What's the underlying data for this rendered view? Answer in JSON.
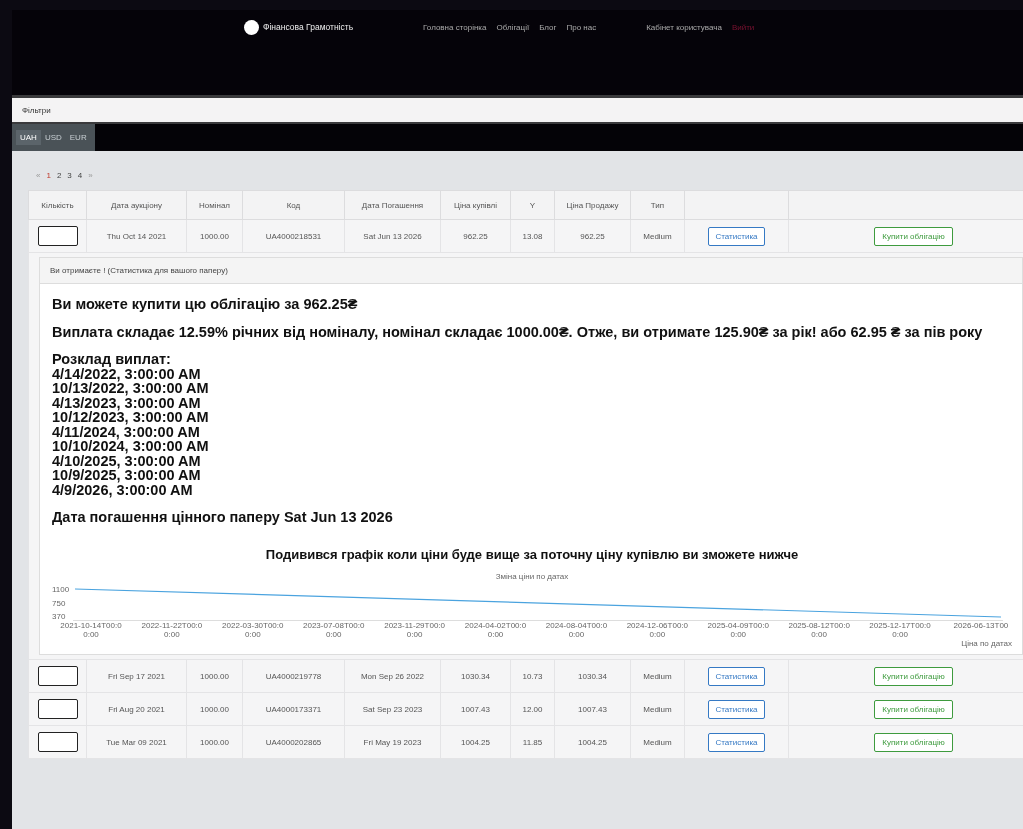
{
  "header": {
    "brand": "Фінансова Грамотність",
    "nav": [
      {
        "label": "Головна сторінка",
        "kind": "link"
      },
      {
        "label": "Облігації",
        "kind": "link"
      },
      {
        "label": "Блог",
        "kind": "link"
      },
      {
        "label": "Про нас",
        "kind": "link"
      },
      {
        "label": "Кабінет користувача",
        "kind": "link"
      },
      {
        "label": "Вийти",
        "kind": "logout"
      }
    ]
  },
  "filter": {
    "label": "Фільтри"
  },
  "currency_tabs": [
    {
      "label": "UAH",
      "selected": true
    },
    {
      "label": "USD",
      "selected": false
    },
    {
      "label": "EUR",
      "selected": false
    }
  ],
  "pagination": {
    "prev": "«",
    "next": "»",
    "pages": [
      {
        "label": "1",
        "selected": true
      },
      {
        "label": "2",
        "selected": false
      },
      {
        "label": "3",
        "selected": false
      },
      {
        "label": "4",
        "selected": false
      }
    ]
  },
  "table": {
    "columns": [
      "Кількість",
      "Дата аукціону",
      "Номінал",
      "Код",
      "Дата Погашення",
      "Ціна купівлі",
      "Y",
      "Ціна Продажу",
      "Тип"
    ],
    "rows": [
      {
        "cells": [
          "",
          "Thu Oct 14 2021",
          "1000.00",
          "UA4000218531",
          "Sat Jun 13 2026",
          "962.25",
          "13.08",
          "962.25",
          "Medium"
        ],
        "stats_button": "Статистика",
        "buy_button": "Купити облігацію",
        "expanded": true
      },
      {
        "cells": [
          "",
          "Fri Sep 17 2021",
          "1000.00",
          "UA4000219778",
          "Mon Sep 26 2022",
          "1030.34",
          "10.73",
          "1030.34",
          "Medium"
        ],
        "stats_button": "Статистика",
        "buy_button": "Купити облігацію",
        "expanded": false
      },
      {
        "cells": [
          "",
          "Fri Aug 20 2021",
          "1000.00",
          "UA4000173371",
          "Sat Sep 23 2023",
          "1007.43",
          "12.00",
          "1007.43",
          "Medium"
        ],
        "stats_button": "Статистика",
        "buy_button": "Купити облігацію",
        "expanded": false
      },
      {
        "cells": [
          "",
          "Tue Mar 09 2021",
          "1000.00",
          "UA4000202865",
          "Fri May 19 2023",
          "1004.25",
          "11.85",
          "1004.25",
          "Medium"
        ],
        "stats_button": "Статистика",
        "buy_button": "Купити облігацію",
        "expanded": false
      }
    ]
  },
  "details": {
    "title": "Ви отримаєте ! (Статистика для вашого папеpу)",
    "price_line": "Ви можете купити цю облігацію за 962.25₴",
    "payout_line": "Виплата складає 12.59% річних від номіналу, номінал складає 1000.00₴. Отже, ви отримате 125.90₴ за рік! або 62.95 ₴ за пів року",
    "schedule_title": "Розклад виплат:",
    "schedule": [
      "4/14/2022, 3:00:00 AM",
      "10/13/2022, 3:00:00 AM",
      "4/13/2023, 3:00:00 AM",
      "10/12/2023, 3:00:00 AM",
      "4/11/2024, 3:00:00 AM",
      "10/10/2024, 3:00:00 AM",
      "4/10/2025, 3:00:00 AM",
      "10/9/2025, 3:00:00 AM",
      "4/9/2026, 3:00:00 AM"
    ],
    "maturity_line": "Дата погашення цінного паперу Sat Jun 13 2026",
    "chart_heading": "Подивився графік коли ціни буде вище за поточну ціну купівлю ви зможете нижче",
    "chart": {
      "title": "Зміна ціни по датах",
      "y_ticks": [
        "1100",
        "750",
        "370"
      ],
      "x_ticks": [
        "2021-10-14T00:00:00",
        "2022-11-22T00:00:00",
        "2022-03-30T00:00:00",
        "2023-07-08T00:00:00",
        "2023-11-29T00:00:00",
        "2024-04-02T00:00:00",
        "2024-08-04T00:00:00",
        "2024-12-06T00:00:00",
        "2025-04-09T00:00:00",
        "2025-08-12T00:00:00",
        "2025-12-17T00:00:00",
        "2026-06-13T00"
      ],
      "legend": "Ціна по датах"
    }
  }
}
